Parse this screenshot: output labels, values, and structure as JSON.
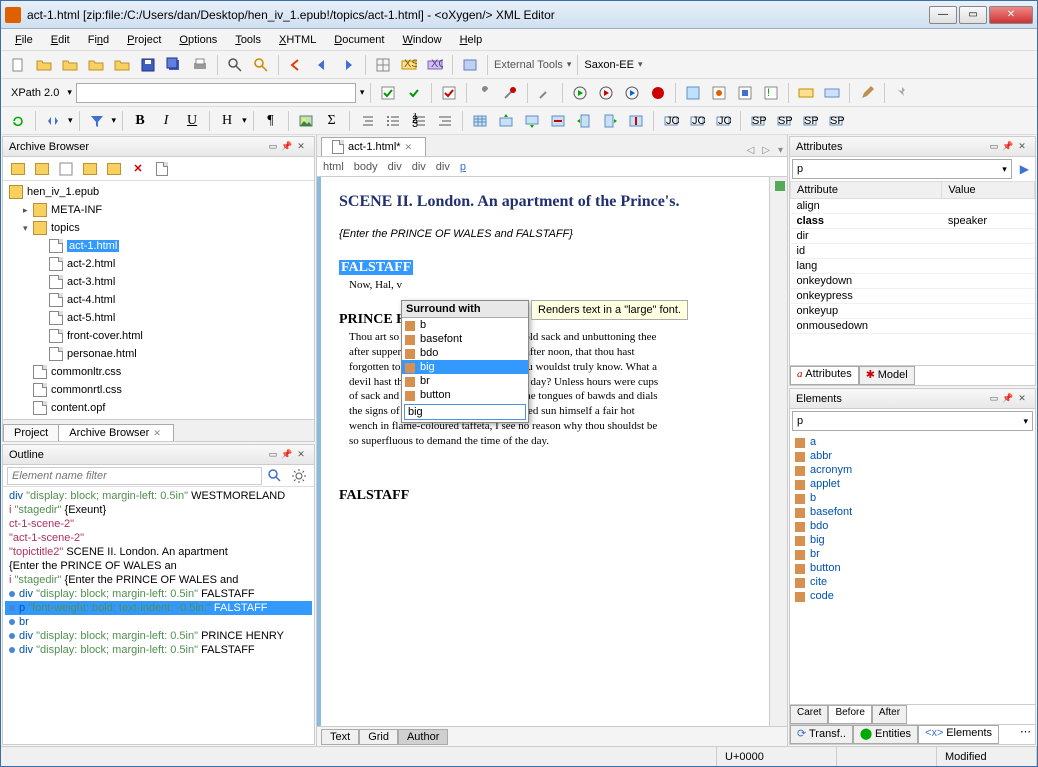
{
  "window": {
    "title": "act-1.html [zip:file:/C:/Users/dan/Desktop/hen_iv_1.epub!/topics/act-1.html] - <oXygen/> XML Editor"
  },
  "menu": [
    "File",
    "Edit",
    "Find",
    "Project",
    "Options",
    "Tools",
    "XHTML",
    "Document",
    "Window",
    "Help"
  ],
  "xpath": {
    "label": "XPath 2.0",
    "value": ""
  },
  "external_tools": "External Tools",
  "transform_engine": "Saxon-EE",
  "left": {
    "archive_panel_title": "Archive Browser",
    "archive_tree": {
      "root": "hen_iv_1.epub",
      "items": [
        {
          "label": "META-INF",
          "type": "folder",
          "indent": 1,
          "expander": "▷"
        },
        {
          "label": "topics",
          "type": "folder",
          "indent": 1,
          "expander": "▲",
          "open": true
        },
        {
          "label": "act-1.html",
          "type": "file",
          "indent": 2,
          "selected": true
        },
        {
          "label": "act-2.html",
          "type": "file",
          "indent": 2
        },
        {
          "label": "act-3.html",
          "type": "file",
          "indent": 2
        },
        {
          "label": "act-4.html",
          "type": "file",
          "indent": 2
        },
        {
          "label": "act-5.html",
          "type": "file",
          "indent": 2
        },
        {
          "label": "front-cover.html",
          "type": "file",
          "indent": 2
        },
        {
          "label": "personae.html",
          "type": "file",
          "indent": 2
        },
        {
          "label": "commonltr.css",
          "type": "file",
          "indent": 1
        },
        {
          "label": "commonrtl.css",
          "type": "file",
          "indent": 1
        },
        {
          "label": "content.opf",
          "type": "file",
          "indent": 1,
          "cut": true
        }
      ]
    },
    "project_tabs": [
      {
        "label": "Project",
        "icon": "project-icon"
      },
      {
        "label": "Archive Browser",
        "icon": "archive-icon",
        "active": true
      }
    ],
    "outline_panel_title": "Outline",
    "outline_filter_placeholder": "Element name filter",
    "outline": [
      {
        "html": "<span class='tag-div'>div</span> <span class='css-span'>\"display: block; margin-left: 0.5in\"</span> WESTMORELAND"
      },
      {
        "html": "<span class='tag-i'>i</span> <span class='css-span'>\"stagedir\"</span> {Exeunt}"
      },
      {
        "html": "<span class='tag-i'>ct-1-scene-2\"</span>"
      },
      {
        "html": "<span class='tag-i'>\"act-1-scene-2\"</span>"
      },
      {
        "html": "<span class='tag-i'>\"topictitle2\"</span> SCENE II. London. An apartment"
      },
      {
        "html": " {Enter the PRINCE OF WALES an"
      },
      {
        "html": "<span class='tag-i'>i</span> <span class='css-span'>\"stagedir\"</span> {Enter the PRINCE OF WALES and"
      },
      {
        "html": "<span class='bullet'></span><span class='tag-div'>div</span> <span class='css-span'>\"display: block; margin-left: 0.5in\"</span> FALSTAFF"
      },
      {
        "html": "<span class='bullet'></span><span class='tag-p'>p</span> <span class='css-span'>\"font-weight: bold; text-indent: -0.5in;\"</span> FALSTAFF",
        "selected": true
      },
      {
        "html": "<span class='bullet'></span><span class='tag-div'>br</span>"
      },
      {
        "html": "<span class='bullet'></span><span class='tag-div'>div</span> <span class='css-span'>\"display: block; margin-left: 0.5in\"</span> PRINCE HENRY"
      },
      {
        "html": "<span class='bullet'></span><span class='tag-div'>div</span> <span class='css-span'>\"display: block; margin-left: 0.5in\"</span> FALSTAFF",
        "cut": true
      }
    ]
  },
  "center": {
    "doc_tab": "act-1.html*",
    "breadcrumb": [
      "html",
      "body",
      "div",
      "div",
      "div",
      "p"
    ],
    "scene_title": "SCENE II. London. An apartment of the Prince's.",
    "stagedir": "{Enter the PRINCE OF WALES and FALSTAFF}",
    "speaker1": "FALSTAFF",
    "speech1": "Now, Hal, v",
    "speaker2": "PRINCE HE",
    "speech2": "Thou art so fat-witted, with drinking of old sack and unbuttoning thee after supper and sleeping upon benches after noon, that thou hast forgotten to demand that truly which thou wouldst truly know. What a devil hast thou to do with the time of the day? Unless hours were cups of sack and minutes capons and clocks the tongues of bawds and dials the signs of leaping-houses and the blessed sun himself a fair hot wench in flame-coloured taffeta, I see no reason why thou shouldst be so superfluous to demand the time of the day.",
    "speaker3": "FALSTAFF",
    "popup": {
      "header": "Surround with",
      "items": [
        "b",
        "basefont",
        "bdo",
        "big",
        "br",
        "button"
      ],
      "selected": "big",
      "input_value": "big"
    },
    "tooltip": "Renders text in a \"large\" font.",
    "bottom_tabs": [
      "Text",
      "Grid",
      "Author"
    ]
  },
  "right": {
    "attributes_panel_title": "Attributes",
    "attributes_context": "p",
    "attr_headers": [
      "Attribute",
      "Value"
    ],
    "attributes": [
      {
        "name": "align",
        "value": ""
      },
      {
        "name": "class",
        "value": "speaker",
        "bold": true
      },
      {
        "name": "dir",
        "value": ""
      },
      {
        "name": "id",
        "value": ""
      },
      {
        "name": "lang",
        "value": ""
      },
      {
        "name": "onkeydown",
        "value": ""
      },
      {
        "name": "onkeypress",
        "value": ""
      },
      {
        "name": "onkeyup",
        "value": ""
      },
      {
        "name": "onmousedown",
        "value": ""
      }
    ],
    "attr_tabs": [
      {
        "label": "Attributes",
        "icon": "a",
        "active": true
      },
      {
        "label": "Model",
        "icon": "m"
      }
    ],
    "elements_panel_title": "Elements",
    "elements_context": "p",
    "elements": [
      "a",
      "abbr",
      "acronym",
      "applet",
      "b",
      "basefont",
      "bdo",
      "big",
      "br",
      "button",
      "cite",
      "code"
    ],
    "caret_tabs": [
      "Caret",
      "Before",
      "After"
    ],
    "bottom_nav": [
      "Transf..",
      "Entities",
      "Elements"
    ]
  },
  "status": {
    "unicode": "U+0000",
    "modified": "Modified"
  }
}
